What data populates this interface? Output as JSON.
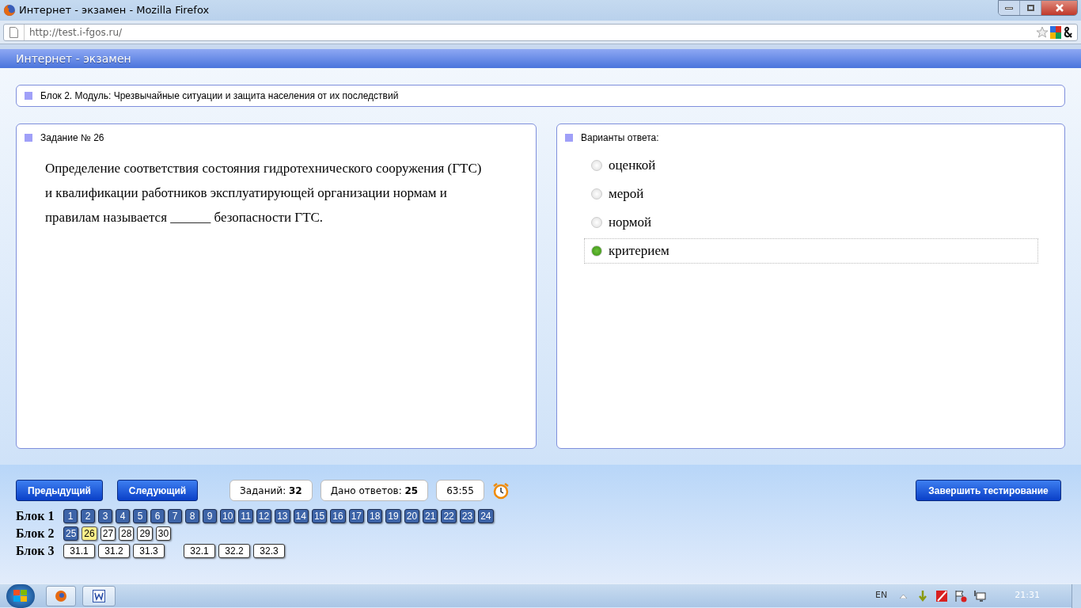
{
  "window": {
    "title": "Интернет - экзамен - Mozilla Firefox"
  },
  "address_bar": {
    "url": "http://test.i-fgos.ru/"
  },
  "app_header": {
    "title": "Интернет - экзамен"
  },
  "block_heading": "Блок 2. Модуль: Чрезвычайные ситуации и защита населения от их последствий",
  "question": {
    "heading": "Задание № 26",
    "text": "Определение соответствия состояния гидротехнического сооружения (ГТС) и квалификации работников эксплуатирующей организации нормам и правилам называется ______ безопасности ГТС."
  },
  "answers": {
    "heading": "Варианты ответа:",
    "options": [
      {
        "label": "оценкой",
        "selected": false
      },
      {
        "label": "мерой",
        "selected": false
      },
      {
        "label": "нормой",
        "selected": false
      },
      {
        "label": "критерием",
        "selected": true
      }
    ]
  },
  "buttons": {
    "previous": "Предыдущий",
    "next": "Следующий",
    "finish": "Завершить тестирование"
  },
  "stats": [
    "Заданий: **32**",
    "Дано ответов: **25**",
    "63:55"
  ],
  "blocks": [
    {
      "label": "Блок 1",
      "groups": [
        [
          {
            "label": "1",
            "answered": true,
            "selected": false
          },
          {
            "label": "2",
            "answered": true,
            "selected": false
          },
          {
            "label": "3",
            "answered": true,
            "selected": false
          },
          {
            "label": "4",
            "answered": true,
            "selected": false
          },
          {
            "label": "5",
            "answered": true,
            "selected": false
          },
          {
            "label": "6",
            "answered": true,
            "selected": false
          },
          {
            "label": "7",
            "answered": true,
            "selected": false
          },
          {
            "label": "8",
            "answered": true,
            "selected": false
          },
          {
            "label": "9",
            "answered": true,
            "selected": false
          },
          {
            "label": "10",
            "answered": true,
            "selected": false
          },
          {
            "label": "11",
            "answered": true,
            "selected": false
          },
          {
            "label": "12",
            "answered": true,
            "selected": false
          },
          {
            "label": "13",
            "answered": true,
            "selected": false
          },
          {
            "label": "14",
            "answered": true,
            "selected": false
          },
          {
            "label": "15",
            "answered": true,
            "selected": false
          },
          {
            "label": "16",
            "answered": true,
            "selected": false
          },
          {
            "label": "17",
            "answered": true,
            "selected": false
          },
          {
            "label": "18",
            "answered": true,
            "selected": false
          },
          {
            "label": "19",
            "answered": true,
            "selected": false
          },
          {
            "label": "20",
            "answered": true,
            "selected": false
          },
          {
            "label": "21",
            "answered": true,
            "selected": false
          },
          {
            "label": "22",
            "answered": true,
            "selected": false
          },
          {
            "label": "23",
            "answered": true,
            "selected": false
          },
          {
            "label": "24",
            "answered": true,
            "selected": false
          }
        ]
      ]
    },
    {
      "label": "Блок 2",
      "groups": [
        [
          {
            "label": "25",
            "answered": true,
            "selected": false
          },
          {
            "label": "26",
            "selected": true
          },
          {
            "label": "27",
            "answered": false,
            "selected": false
          },
          {
            "label": "28",
            "answered": false,
            "selected": false
          },
          {
            "label": "29",
            "answered": false,
            "selected": false
          },
          {
            "label": "30",
            "answered": false,
            "selected": false
          }
        ]
      ]
    },
    {
      "label": "Блок 3",
      "groups": [
        [
          {
            "label": "31.1",
            "answered": false,
            "selected": false
          },
          {
            "label": "31.2",
            "answered": false,
            "selected": false
          },
          {
            "label": "31.3",
            "answered": false,
            "selected": false
          }
        ],
        [
          {
            "label": "32.1",
            "answered": false,
            "selected": false
          },
          {
            "label": "32.2",
            "answered": false,
            "selected": false
          },
          {
            "label": "32.3",
            "answered": false,
            "selected": false
          }
        ]
      ]
    }
  ],
  "taskbar": {
    "language": "EN",
    "clock": "21:31"
  }
}
